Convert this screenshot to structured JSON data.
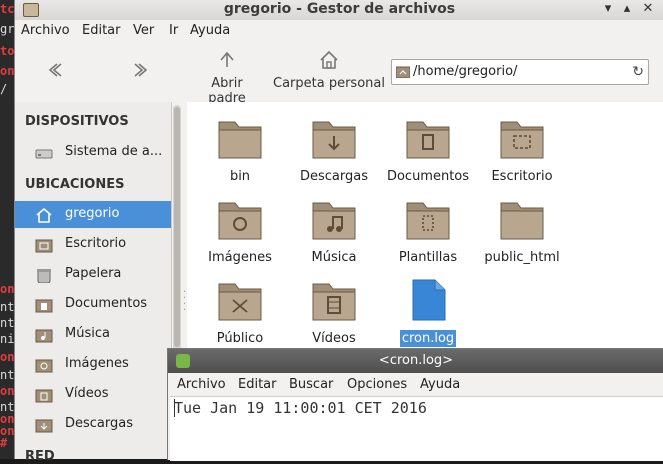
{
  "terminal": {
    "lines": [
      "tco",
      "gr",
      "to",
      "on",
      "/",
      "on",
      "nt",
      "nt",
      "ni",
      "on",
      "nt",
      "on",
      "nt",
      "on",
      "on",
      "#"
    ]
  },
  "window": {
    "title": "gregorio - Gestor de archivos",
    "minimize": "▾",
    "maximize": "▴",
    "close": "✕"
  },
  "menu": {
    "archivo": "Archivo",
    "editar": "Editar",
    "ver": "Ver",
    "ir": "Ir",
    "ayuda": "Ayuda"
  },
  "toolbar": {
    "back_icon": "back-icon",
    "forward_icon": "forward-icon",
    "up_label": "Abrir padre",
    "home_label": "Carpeta personal"
  },
  "location": {
    "path": "/home/gregorio/",
    "reload": "↻"
  },
  "sidebar": {
    "devices_header": "DISPOSITIVOS",
    "filesystem": "Sistema de a...",
    "places_header": "UBICACIONES",
    "places": [
      "gregorio",
      "Escritorio",
      "Papelera",
      "Documentos",
      "Música",
      "Imágenes",
      "Vídeos",
      "Descargas"
    ],
    "network_header": "RED"
  },
  "files": [
    "bin",
    "Descargas",
    "Documentos",
    "Escritorio",
    "Imágenes",
    "Música",
    "Plantillas",
    "public_html",
    "Público",
    "Vídeos",
    "cron.log"
  ],
  "selected_file": "cron.log",
  "editor": {
    "title": "<cron.log>",
    "menu": [
      "Archivo",
      "Editar",
      "Buscar",
      "Opciones",
      "Ayuda"
    ],
    "content": "Tue Jan 19 11:00:01 CET 2016"
  },
  "colors": {
    "selection": "#4a90d9",
    "folder": "#a08f78",
    "folder_dark": "#6b5a45",
    "file_blue": "#3a86d6"
  }
}
